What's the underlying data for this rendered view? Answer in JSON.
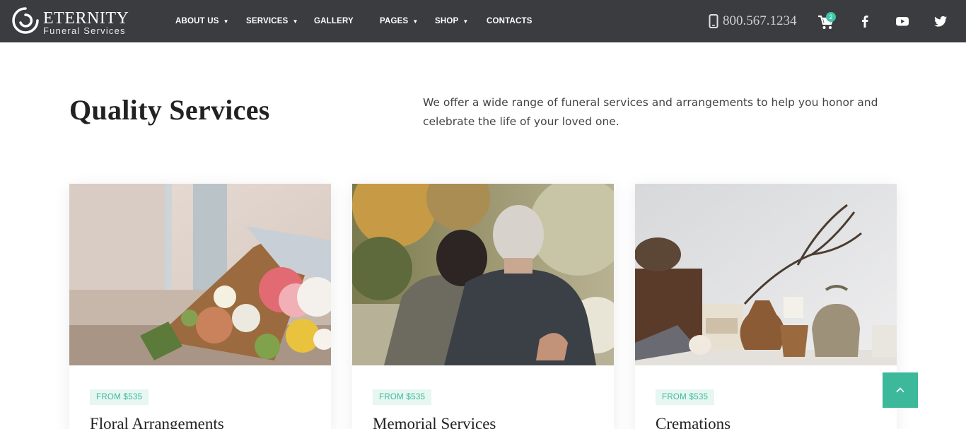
{
  "brand": {
    "title": "ETERNITY",
    "subtitle": "Funeral Services",
    "logo_icon": "circle-swirl-logo-icon"
  },
  "nav": {
    "items": [
      {
        "label": "ABOUT US",
        "has_dropdown": true
      },
      {
        "label": "SERVICES",
        "has_dropdown": true
      },
      {
        "label": "GALLERY",
        "has_dropdown": false
      },
      {
        "label": "PAGES",
        "has_dropdown": true
      },
      {
        "label": "SHOP",
        "has_dropdown": true
      },
      {
        "label": "CONTACTS",
        "has_dropdown": false
      }
    ],
    "caret": "▼"
  },
  "contact": {
    "phone": "800.567.1234",
    "phone_icon": "mobile-phone-icon"
  },
  "cart": {
    "icon": "shopping-cart-icon",
    "count": "2"
  },
  "social": [
    {
      "icon": "facebook-icon"
    },
    {
      "icon": "youtube-icon"
    },
    {
      "icon": "twitter-icon"
    }
  ],
  "section": {
    "title": "Quality Services",
    "description": "We offer a wide range of funeral services and arrangements to help you honor and celebrate the life of your loved one."
  },
  "cards": [
    {
      "price": "FROM $535",
      "title": "Floral Arrangements",
      "image": "flower-bouquet-photo"
    },
    {
      "price": "FROM $535",
      "title": "Memorial Services",
      "image": "elderly-couple-embracing-photo"
    },
    {
      "price": "FROM $535",
      "title": "Cremations",
      "image": "urns-and-candles-still-life-photo"
    }
  ],
  "scroll_top": {
    "icon": "chevron-up-icon"
  },
  "colors": {
    "header_bg": "#3a3c3f",
    "accent": "#3cb89b",
    "badge_bg": "#e6f6f1",
    "badge_text": "#3cba9a"
  }
}
